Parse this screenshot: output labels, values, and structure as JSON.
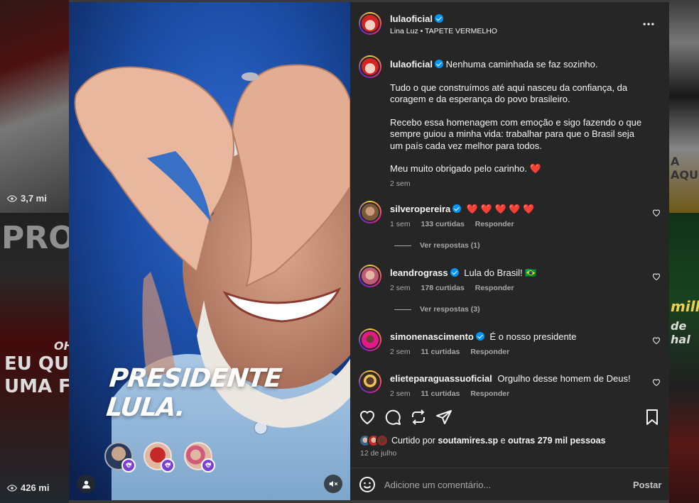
{
  "background": {
    "view_counts": [
      "3,7 mi",
      "426 mi"
    ],
    "tile_texts": [
      "PRO",
      "EU QUE",
      "UMA F",
      "OH",
      "A AQU",
      "milh",
      "de hal"
    ]
  },
  "post": {
    "username": "lulaoficial",
    "audio_artist": "Lina Luz",
    "audio_separator": "•",
    "audio_title": "TAPETE VERMELHO",
    "more_icon": "more-horizontal-icon",
    "media_overlay_text": "PRESIDENTE LULA.",
    "caption": {
      "first_line": "Nenhuma caminhada se faz sozinho.",
      "paragraph_2": "Tudo o que construímos até aqui nasceu da confiança, da coragem e da esperança do povo brasileiro.",
      "paragraph_3": "Recebo essa homenagem com emoção e sigo fazendo o que sempre guiou a minha vida: trabalhar para que o Brasil seja um país cada vez melhor para todos.",
      "paragraph_4": "Meu muito obrigado pelo carinho. ❤️",
      "time": "2 sem"
    },
    "comments": [
      {
        "username": "silveropereira",
        "verified": true,
        "text": "❤️ ❤️ ❤️ ❤️ ❤️",
        "time": "1 sem",
        "likes": "133 curtidas",
        "reply": "Responder",
        "view_replies": "Ver respostas (1)"
      },
      {
        "username": "leandrograss",
        "verified": true,
        "text": "Lula do Brasil! 🇧🇷",
        "time": "2 sem",
        "likes": "178 curtidas",
        "reply": "Responder",
        "view_replies": "Ver respostas (3)"
      },
      {
        "username": "simonenascimento",
        "verified": true,
        "text": "É o nosso presidente",
        "time": "2 sem",
        "likes": "11 curtidas",
        "reply": "Responder"
      },
      {
        "username": "elieteparaguassuoficial",
        "verified": false,
        "text": "Orgulho desse homem de Deus!",
        "time": "2 sem",
        "likes": "11 curtidas",
        "reply": "Responder"
      }
    ],
    "likes": {
      "prefix": "Curtido por",
      "user": "soutamires.sp",
      "conjunction": "e",
      "others": "outras 279 mil pessoas"
    },
    "date": "12 de julho",
    "comment_box": {
      "placeholder": "Adicione um comentário...",
      "post_button": "Postar"
    }
  },
  "colors": {
    "panel_bg": "#262626",
    "verified_blue": "#0095f6",
    "heart_red": "#ff3040",
    "secondary_text": "#a8a8a8"
  }
}
